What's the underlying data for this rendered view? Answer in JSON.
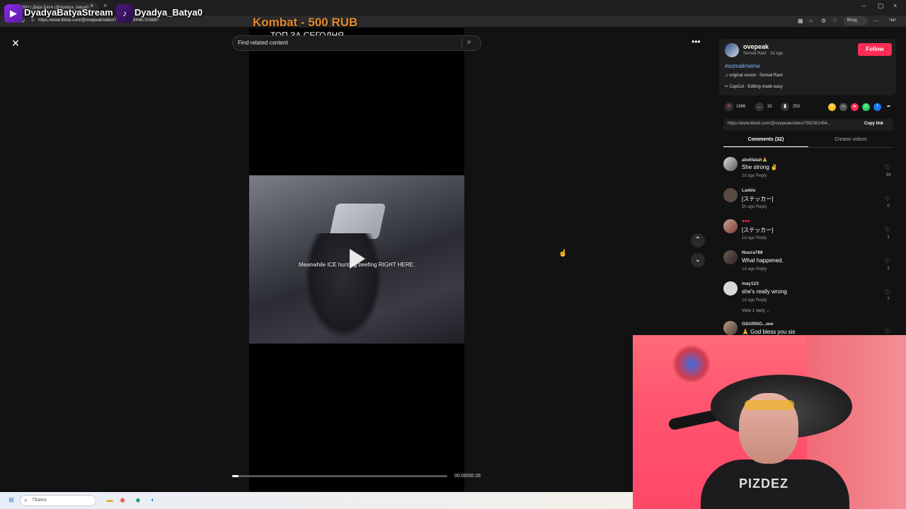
{
  "browser": {
    "tab_title": "(99+) Дядя Батя (@dyadya_batya0",
    "url": "https://www.tiktok.com/@ovepeak/video/7592361494487108887",
    "profile_label": "Вход",
    "chat_label": "Чат"
  },
  "overlay": {
    "stream_name": "DyadyaBatyaStream",
    "channel_name": "Dyadya_Batya0",
    "kombat": "Kombat - 500 RUB",
    "kombat_sub": "ТОП ЗА СЕГОДНЯ"
  },
  "player": {
    "search_placeholder": "Find related content",
    "caption": "Meanwhile ICE hunting     beefing RIGHT HERE.",
    "time": "00:00/00:28",
    "progress": 0.03
  },
  "post": {
    "author": "ovepeak",
    "meta": "Somali Rant · 3d ago",
    "follow_label": "Follow",
    "hashtag": "#somalimeme",
    "sound": "♫  original sound - Somali Rant",
    "capcut": "✂  CapCut · Editing made easy",
    "likes": "1696",
    "comments": "32",
    "saves": "253",
    "link": "https://www.tiktok.com/@ovepeak/video/7592361494...",
    "copy_link_label": "Copy link",
    "tab_comments": "Comments (32)",
    "tab_creator": "Creator videos"
  },
  "comments": [
    {
      "user": "abdifatah🙏",
      "text": "She strong ✌",
      "meta": "2d ago     Reply",
      "likes": "34"
    },
    {
      "user": "Laddu",
      "text": "[ステッカー]",
      "meta": "5h ago     Reply",
      "likes": "0"
    },
    {
      "user": "♥♥♥",
      "text": "[ステッカー]",
      "meta": "1d ago     Reply",
      "likes": "1"
    },
    {
      "user": "Nuura788",
      "text": "What happened.",
      "meta": "1d ago     Reply",
      "likes": "1"
    },
    {
      "user": "may123",
      "text": "she's really wrong",
      "meta": "1d ago     Reply",
      "likes": "7"
    },
    {
      "user": "OSORNO...ww",
      "text": "🙏 God bless you sis",
      "meta": "",
      "likes": ""
    }
  ],
  "view_reply": "View 1 reply ⌄",
  "taskbar": {
    "search_label": "Поиск"
  },
  "webcam": {
    "shirt_text": "PIZDEZ"
  }
}
